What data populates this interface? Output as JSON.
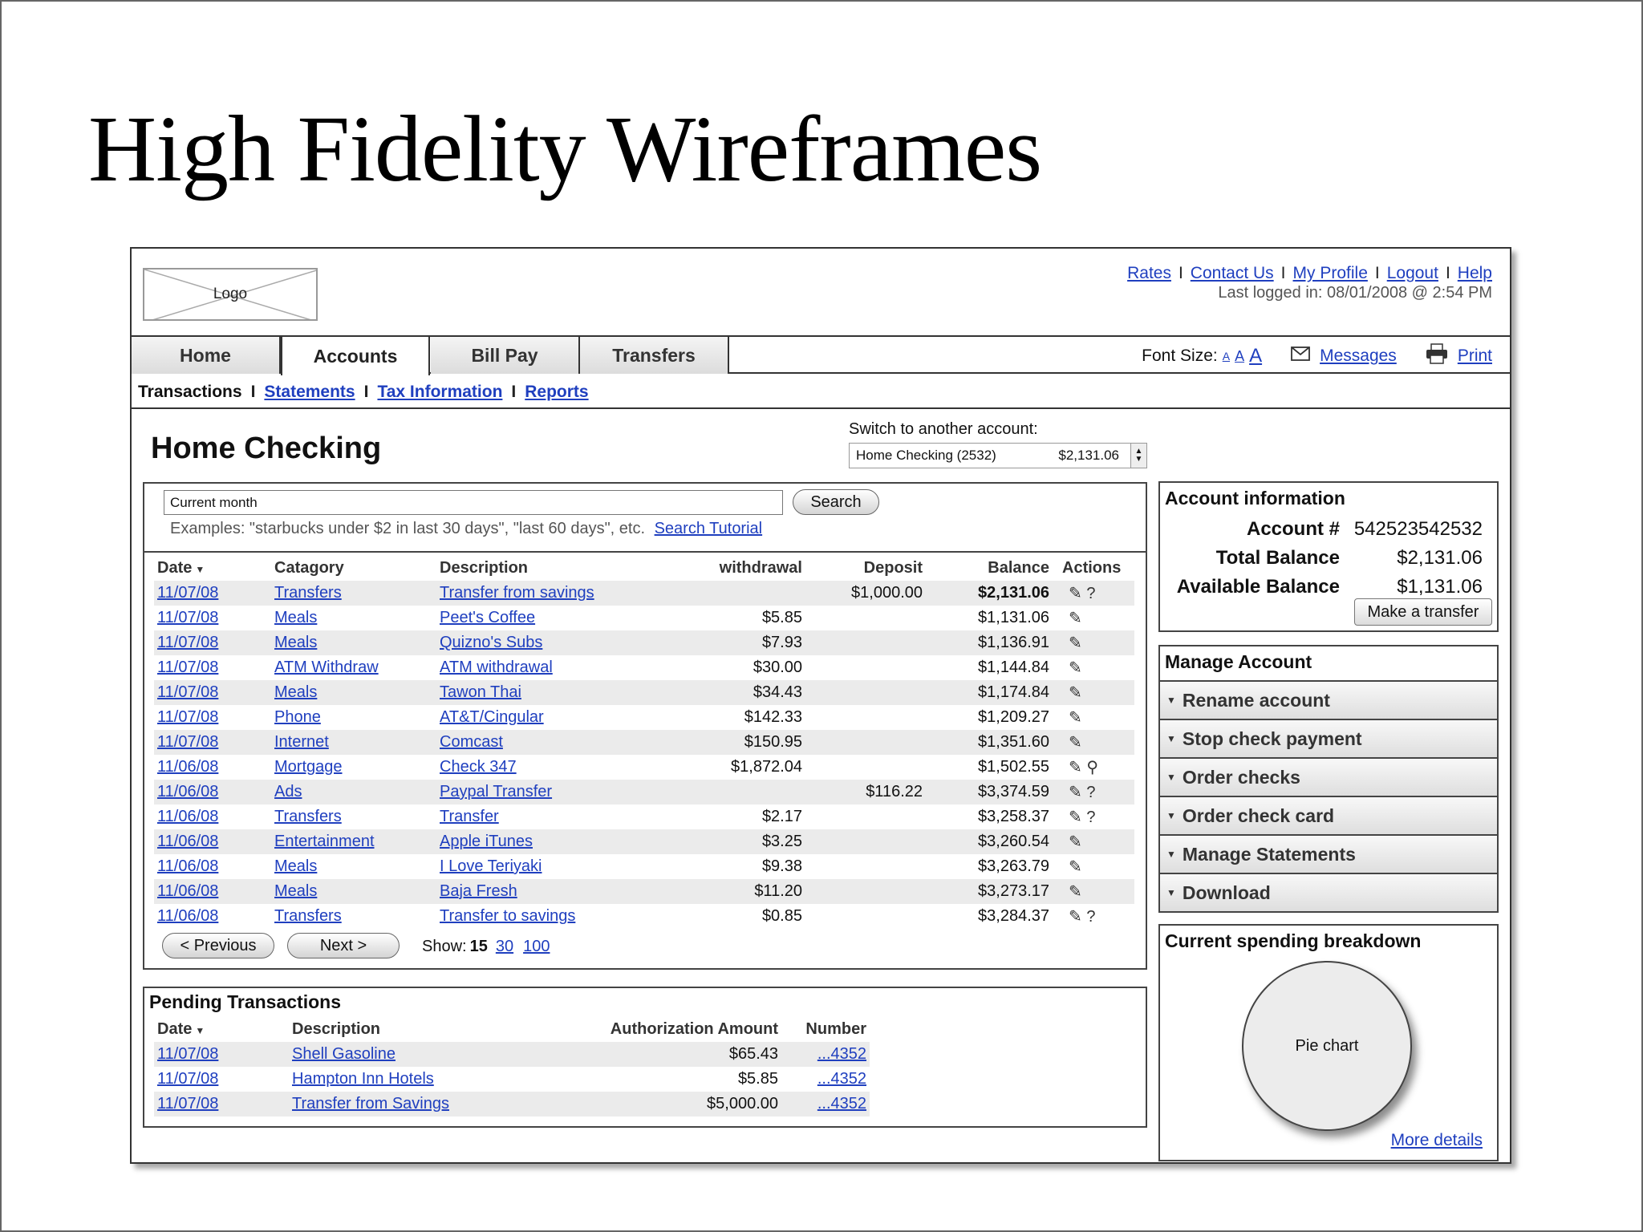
{
  "slide": {
    "title": "High Fidelity Wireframes"
  },
  "header": {
    "logo_label": "Logo",
    "links": [
      "Rates",
      "Contact Us",
      "My Profile",
      "Logout",
      "Help"
    ],
    "last_login": "Last logged in: 08/01/2008 @ 2:54 PM"
  },
  "nav": {
    "tabs": [
      "Home",
      "Accounts",
      "Bill Pay",
      "Transfers"
    ],
    "active_tab": "Accounts",
    "font_size_label": "Font Size:",
    "font_size_options": [
      "A",
      "A",
      "A"
    ],
    "messages_label": "Messages",
    "print_label": "Print"
  },
  "subnav": {
    "current": "Transactions",
    "links": [
      "Statements",
      "Tax Information",
      "Reports"
    ]
  },
  "account": {
    "title": "Home Checking",
    "switch_label": "Switch to another account:",
    "switch_selected": "Home Checking (2532)",
    "switch_amount": "$2,131.06"
  },
  "search": {
    "value": "Current month",
    "button": "Search",
    "examples": "Examples: \"starbucks under $2 in last 30 days\", \"last 60 days\", etc.",
    "tutorial_link": "Search Tutorial"
  },
  "transactions": {
    "columns": [
      "Date",
      "Catagory",
      "Description",
      "withdrawal",
      "Deposit",
      "Balance",
      "Actions"
    ],
    "rows": [
      {
        "date": "11/07/08",
        "category": "Transfers",
        "description": "Transfer from savings",
        "withdrawal": "",
        "deposit": "$1,000.00",
        "balance": "$2,131.06",
        "actions": "✎ ?"
      },
      {
        "date": "11/07/08",
        "category": "Meals",
        "description": "Peet's Coffee",
        "withdrawal": "$5.85",
        "deposit": "",
        "balance": "$1,131.06",
        "actions": "✎"
      },
      {
        "date": "11/07/08",
        "category": "Meals",
        "description": "Quizno's Subs",
        "withdrawal": "$7.93",
        "deposit": "",
        "balance": "$1,136.91",
        "actions": "✎"
      },
      {
        "date": "11/07/08",
        "category": "ATM Withdraw",
        "description": "ATM withdrawal",
        "withdrawal": "$30.00",
        "deposit": "",
        "balance": "$1,144.84",
        "actions": "✎"
      },
      {
        "date": "11/07/08",
        "category": "Meals",
        "description": "Tawon Thai",
        "withdrawal": "$34.43",
        "deposit": "",
        "balance": "$1,174.84",
        "actions": "✎"
      },
      {
        "date": "11/07/08",
        "category": "Phone",
        "description": "AT&T/Cingular",
        "withdrawal": "$142.33",
        "deposit": "",
        "balance": "$1,209.27",
        "actions": "✎"
      },
      {
        "date": "11/07/08",
        "category": "Internet",
        "description": "Comcast",
        "withdrawal": "$150.95",
        "deposit": "",
        "balance": "$1,351.60",
        "actions": "✎"
      },
      {
        "date": "11/06/08",
        "category": "Mortgage",
        "description": "Check 347",
        "withdrawal": "$1,872.04",
        "deposit": "",
        "balance": "$1,502.55",
        "actions": "✎ ⚲"
      },
      {
        "date": "11/06/08",
        "category": "Ads",
        "description": "Paypal Transfer",
        "withdrawal": "",
        "deposit": "$116.22",
        "balance": "$3,374.59",
        "actions": "✎ ?"
      },
      {
        "date": "11/06/08",
        "category": "Transfers",
        "description": "Transfer",
        "withdrawal": "$2.17",
        "deposit": "",
        "balance": "$3,258.37",
        "actions": "✎ ?"
      },
      {
        "date": "11/06/08",
        "category": "Entertainment",
        "description": "Apple iTunes",
        "withdrawal": "$3.25",
        "deposit": "",
        "balance": "$3,260.54",
        "actions": "✎"
      },
      {
        "date": "11/06/08",
        "category": "Meals",
        "description": "I Love Teriyaki",
        "withdrawal": "$9.38",
        "deposit": "",
        "balance": "$3,263.79",
        "actions": "✎"
      },
      {
        "date": "11/06/08",
        "category": "Meals",
        "description": "Baja Fresh",
        "withdrawal": "$11.20",
        "deposit": "",
        "balance": "$3,273.17",
        "actions": "✎"
      },
      {
        "date": "11/06/08",
        "category": "Transfers",
        "description": "Transfer to savings",
        "withdrawal": "$0.85",
        "deposit": "",
        "balance": "$3,284.37",
        "actions": "✎ ?"
      }
    ],
    "prev_label": "< Previous",
    "next_label": "Next >",
    "show_label": "Show:",
    "show_current": "15",
    "show_options": [
      "30",
      "100"
    ]
  },
  "pending": {
    "title": "Pending Transactions",
    "columns": [
      "Date",
      "Description",
      "Authorization Amount",
      "Number"
    ],
    "rows": [
      {
        "date": "11/07/08",
        "description": "Shell Gasoline",
        "amount": "$65.43",
        "number": "...4352"
      },
      {
        "date": "11/07/08",
        "description": "Hampton Inn Hotels",
        "amount": "$5.85",
        "number": "...4352"
      },
      {
        "date": "11/07/08",
        "description": "Transfer from Savings",
        "amount": "$5,000.00",
        "number": "...4352"
      }
    ]
  },
  "account_info": {
    "title": "Account information",
    "fields": [
      {
        "label": "Account #",
        "value": "542523542532"
      },
      {
        "label": "Total Balance",
        "value": "$2,131.06"
      },
      {
        "label": "Available Balance",
        "value": "$1,131.06"
      }
    ],
    "transfer_button": "Make a transfer"
  },
  "manage": {
    "title": "Manage Account",
    "items": [
      "Rename account",
      "Stop check payment",
      "Order checks",
      "Order check card",
      "Manage Statements",
      "Download"
    ]
  },
  "spending": {
    "title": "Current spending breakdown",
    "pie_label": "Pie chart",
    "more_link": "More details"
  }
}
